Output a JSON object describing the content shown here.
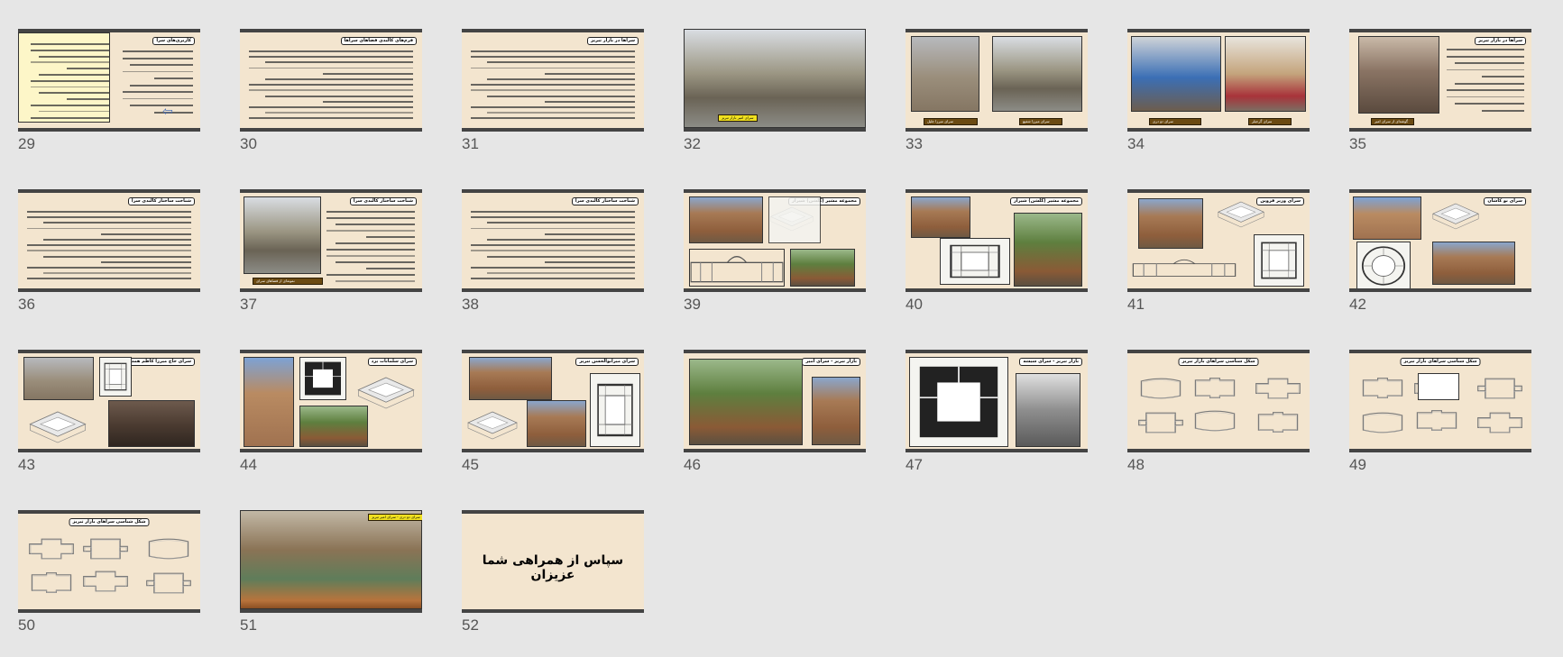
{
  "slides": [
    {
      "number": "29",
      "title": "کاربری‌های سرا",
      "kind": "text-box"
    },
    {
      "number": "30",
      "title": "فرم‌های کالبدی فضاهای سراها",
      "kind": "text"
    },
    {
      "number": "31",
      "title": "سراها در بازار تبریز",
      "kind": "text"
    },
    {
      "number": "32",
      "title": "",
      "caption": "سرای امیر بازار تبریز",
      "kind": "photo-full"
    },
    {
      "number": "33",
      "title": "",
      "caption": "سرای میرزا جلیل",
      "caption2": "سرای میرزا شفیع",
      "kind": "photo-two"
    },
    {
      "number": "34",
      "title": "",
      "caption": "سرای دو دری",
      "caption2": "سرای گرجیلر",
      "kind": "photo-two"
    },
    {
      "number": "35",
      "title": "سراها در بازار تبریز",
      "caption": "گوشه‌ای از سرای امیر",
      "kind": "photo-text"
    },
    {
      "number": "36",
      "title": "شناخت ساختار کالبدی سرا",
      "kind": "text"
    },
    {
      "number": "37",
      "title": "شناخت ساختار کالبدی سرا",
      "caption": "نمونه‌ای از فضاهای سرای",
      "kind": "photo-text"
    },
    {
      "number": "38",
      "title": "شناخت ساختار کالبدی سرا",
      "kind": "text"
    },
    {
      "number": "39",
      "title": "مجموعه مشیر (گلشن) شیراز",
      "kind": "collage-a"
    },
    {
      "number": "40",
      "title": "مجموعه مشیر (گلشن) شیراز",
      "kind": "collage-b"
    },
    {
      "number": "41",
      "title": "سرای وزیر قزوین",
      "kind": "collage-c"
    },
    {
      "number": "42",
      "title": "سرای نو کاشان",
      "kind": "collage-d"
    },
    {
      "number": "43",
      "title": "سرای حاج میرزا کاظم همدان",
      "kind": "collage-e"
    },
    {
      "number": "44",
      "title": "سرای سلمانات یزد",
      "kind": "collage-f"
    },
    {
      "number": "45",
      "title": "سرای میرابوالحسن تبریز",
      "kind": "collage-g"
    },
    {
      "number": "46",
      "title": "بازار تبریز - سرای امیر",
      "kind": "collage-h"
    },
    {
      "number": "47",
      "title": "بازار تبریز - سرای شیشه",
      "kind": "collage-i"
    },
    {
      "number": "48",
      "title": "شکل شناسی سراهای بازار تبریز",
      "kind": "plans"
    },
    {
      "number": "49",
      "title": "شکل شناسی سراهای بازار تبریز",
      "kind": "plans"
    },
    {
      "number": "50",
      "title": "شکل شناسی سراهای بازار تبریز",
      "kind": "plans"
    },
    {
      "number": "51",
      "title": "",
      "caption": "سرای دو دری - سرای امیر تبریز",
      "kind": "photo-tree"
    },
    {
      "number": "52",
      "title": "",
      "body": "سپاس از همراهی شما عزیزان",
      "kind": "final"
    }
  ],
  "colors": {
    "background": "#e6e6e6",
    "slide_bg": "#f3e5cf",
    "slide_frame": "#444444",
    "caption_brown": "#6b4a12",
    "caption_yellow": "#f0e020"
  }
}
